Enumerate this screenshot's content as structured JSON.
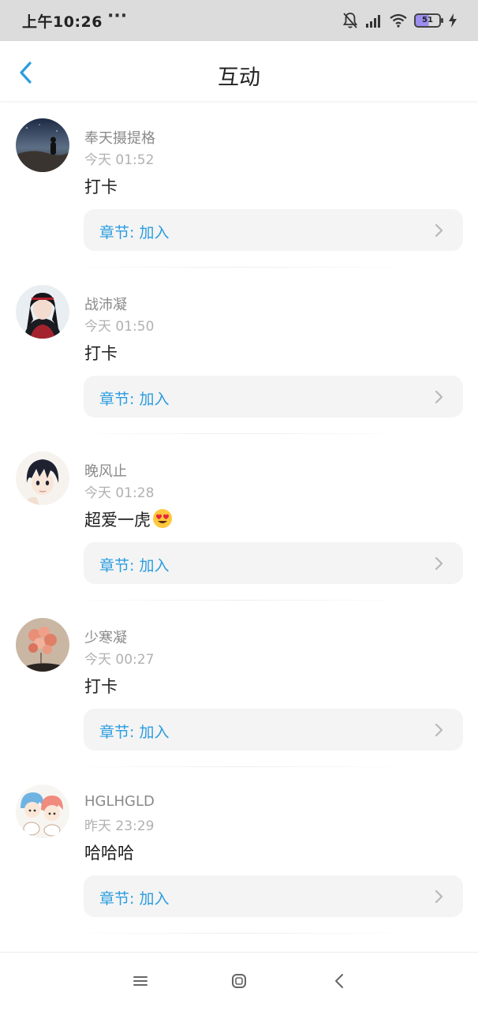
{
  "status_bar": {
    "time": "上午10:26",
    "dots": "···",
    "battery_level": "51",
    "icons": [
      "bell-muted-icon",
      "signal-icon",
      "wifi-icon",
      "battery-icon",
      "charging-bolt-icon"
    ]
  },
  "header": {
    "title": "互动",
    "back_icon": "chevron-left-icon"
  },
  "colors": {
    "accent": "#2a9de0",
    "username": "#8a8a8a",
    "timestamp": "#b1b1b1",
    "card_bg": "#f4f4f4"
  },
  "feed": [
    {
      "username": "奉天摄提格",
      "time": "今天 01:52",
      "content": "打卡",
      "chapter_label": "章节: 加入",
      "avatar_icon": "night-sky-avatar"
    },
    {
      "username": "战沛凝",
      "time": "今天 01:50",
      "content": "打卡",
      "chapter_label": "章节: 加入",
      "avatar_icon": "anime-character-avatar"
    },
    {
      "username": "晚风止",
      "time": "今天 01:28",
      "content": "超爱一虎",
      "emoji": "heart-eyes-emoji",
      "chapter_label": "章节: 加入",
      "avatar_icon": "anime-boy-avatar"
    },
    {
      "username": "少寒凝",
      "time": "今天 00:27",
      "content": "打卡",
      "chapter_label": "章节: 加入",
      "avatar_icon": "balloons-avatar"
    },
    {
      "username": "HGLHGLD",
      "time": "昨天 23:29",
      "content": "哈哈哈",
      "chapter_label": "章节: 加入",
      "avatar_icon": "cartoon-pair-avatar"
    }
  ],
  "nav_bar": {
    "buttons": [
      "menu-icon",
      "home-icon",
      "back-icon"
    ]
  }
}
